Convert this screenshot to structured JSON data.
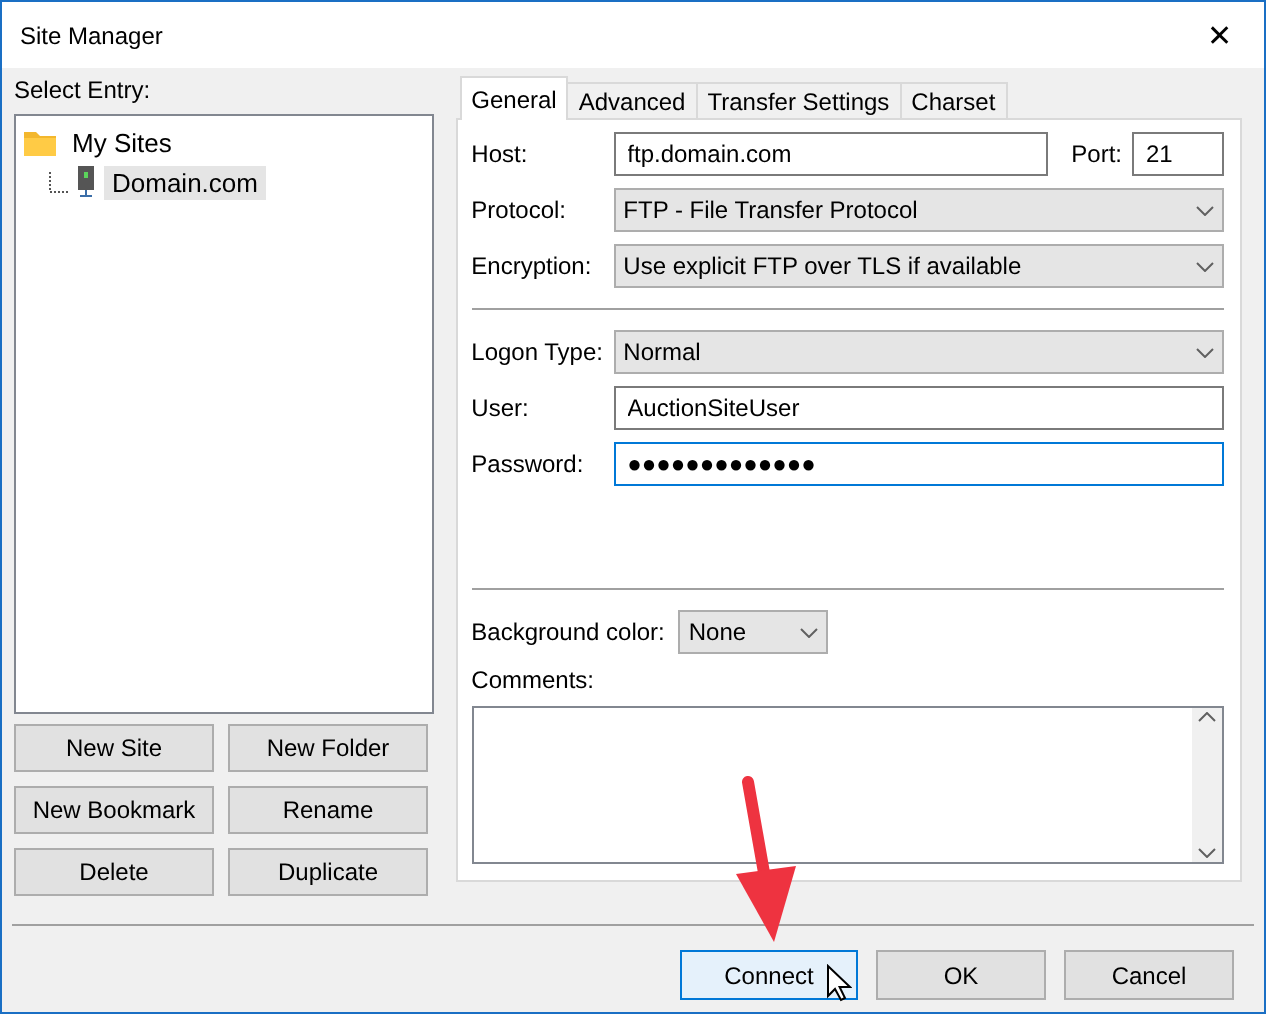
{
  "window": {
    "title": "Site Manager",
    "close": "✕"
  },
  "select_entry_label": "Select Entry:",
  "tree": [
    {
      "label": "My Sites",
      "kind": "folder",
      "selected": false,
      "children": [
        {
          "label": "Domain.com",
          "kind": "site",
          "selected": true
        }
      ]
    }
  ],
  "site_buttons": [
    "New Site",
    "New Folder",
    "New Bookmark",
    "Rename",
    "Delete",
    "Duplicate"
  ],
  "tabs": [
    {
      "label": "General",
      "selected": true
    },
    {
      "label": "Advanced",
      "selected": false
    },
    {
      "label": "Transfer Settings",
      "selected": false
    },
    {
      "label": "Charset",
      "selected": false
    }
  ],
  "host": {
    "label": "Host:",
    "value": "ftp.domain.com",
    "port_label": "Port:",
    "port": "21"
  },
  "connection_fields": [
    {
      "label": "Protocol:",
      "kind": "select",
      "value": "FTP - File Transfer Protocol",
      "focused": false
    },
    {
      "label": "Encryption:",
      "kind": "select",
      "value": "Use explicit FTP over TLS if available",
      "focused": false
    }
  ],
  "login_fields": [
    {
      "label": "Logon Type:",
      "kind": "select",
      "value": "Normal",
      "focused": false
    },
    {
      "label": "User:",
      "kind": "text",
      "value": "AuctionSiteUser",
      "focused": false
    },
    {
      "label": "Password:",
      "kind": "text",
      "value": "●●●●●●●●●●●●●",
      "focused": true
    }
  ],
  "background_color": {
    "label": "Background color:",
    "value": "None"
  },
  "comments": {
    "label": "Comments:"
  },
  "dialog_buttons": [
    {
      "label": "Connect",
      "highlighted": true
    },
    {
      "label": "OK",
      "highlighted": false
    },
    {
      "label": "Cancel",
      "highlighted": false
    }
  ]
}
